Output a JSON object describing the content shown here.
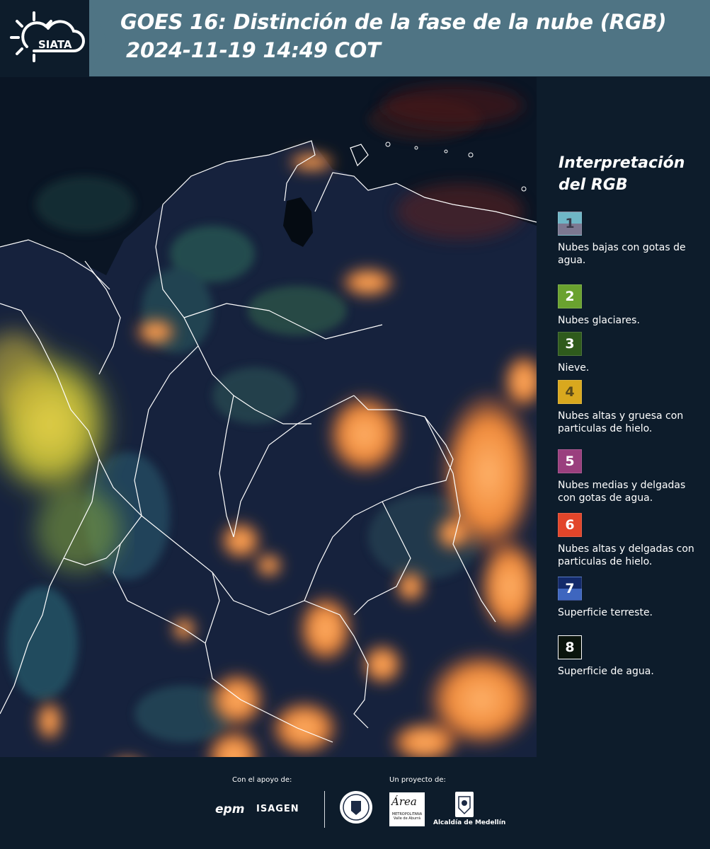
{
  "header": {
    "logo_text": "SIATA",
    "title_line1": "GOES 16: Distinción de la fase de la nube (RGB)",
    "title_line2": "2024-11-19 14:49 COT"
  },
  "legend": {
    "title": "Interpretación del RGB",
    "items": [
      {
        "number": "1",
        "label": "Nubes bajas con gotas de agua.",
        "color_top": "#6fb6c6",
        "color_bottom": "#7c7891",
        "text_color": "#3a3a4a"
      },
      {
        "number": "2",
        "label": "Nubes glaciares.",
        "color_top": "#6aa22f",
        "color_bottom": "#6aa22f",
        "text_color": "#ffffff"
      },
      {
        "number": "3",
        "label": "Nieve.",
        "color_top": "#2f5b1c",
        "color_bottom": "#2f5b1c",
        "text_color": "#ffffff"
      },
      {
        "number": "4",
        "label": "Nubes altas y gruesa con particulas de hielo.",
        "color_top": "#d9a81e",
        "color_bottom": "#d9a81e",
        "text_color": "#5a4a1a"
      },
      {
        "number": "5",
        "label": "Nubes medias y delgadas con gotas de agua.",
        "color_top": "#9a3f7e",
        "color_bottom": "#9a3f7e",
        "text_color": "#ffffff"
      },
      {
        "number": "6",
        "label": "Nubes altas y delgadas con particulas de hielo.",
        "color_top": "#e2452a",
        "color_bottom": "#e2452a",
        "text_color": "#ffffff"
      },
      {
        "number": "7",
        "label": "Superficie terreste.",
        "color_top": "#132a6b",
        "color_bottom": "#3e66bf",
        "text_color": "#ffffff"
      },
      {
        "number": "8",
        "label": "Superficie de agua.",
        "color_top": "#0a140c",
        "color_bottom": "#0a140c",
        "text_color": "#ffffff"
      }
    ]
  },
  "footer": {
    "support_caption": "Con el apoyo de:",
    "project_caption": "Un proyecto de:",
    "sponsor1": "epm",
    "sponsor2": "ISAGEN",
    "area_logo_text": "Área",
    "area_logo_sub": "METROPOLITANA Valle de Aburrá",
    "alcaldia": "Alcaldía de Medellín"
  },
  "map": {
    "description_colors": {
      "water": "#0b1626",
      "land": "#17233f",
      "thick_ice_cloud": "#f08a3a",
      "glaciated_cloud": "#c8c23a",
      "borders": "#ffffff"
    }
  }
}
